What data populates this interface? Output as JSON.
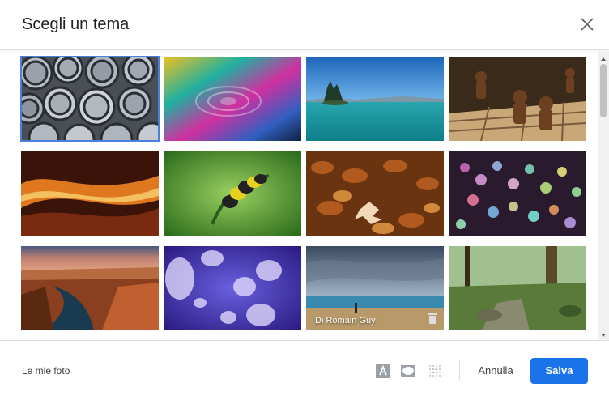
{
  "dialog": {
    "title": "Scegli un tema",
    "close_icon": "close-icon"
  },
  "themes": [
    {
      "name": "metal-pipes",
      "selected": true
    },
    {
      "name": "colorful-water-ripples"
    },
    {
      "name": "lake-with-islands"
    },
    {
      "name": "chess-pieces"
    },
    {
      "name": "canyon-waves"
    },
    {
      "name": "caterpillar"
    },
    {
      "name": "autumn-leaves"
    },
    {
      "name": "bokeh-lights"
    },
    {
      "name": "canyon-river"
    },
    {
      "name": "jellyfish"
    },
    {
      "name": "beach-sky",
      "caption": "Di Romain Guy",
      "delete_icon": "trash-icon"
    },
    {
      "name": "forest-stream"
    }
  ],
  "footer": {
    "my_photos_label": "Le mie foto",
    "text_color_icon": "text-color-icon",
    "vignette_icon": "vignette-icon",
    "blur_icon": "blur-icon",
    "cancel_label": "Annulla",
    "save_label": "Salva"
  },
  "colors": {
    "accent": "#1a73e8",
    "selection": "#4a7fdb"
  }
}
